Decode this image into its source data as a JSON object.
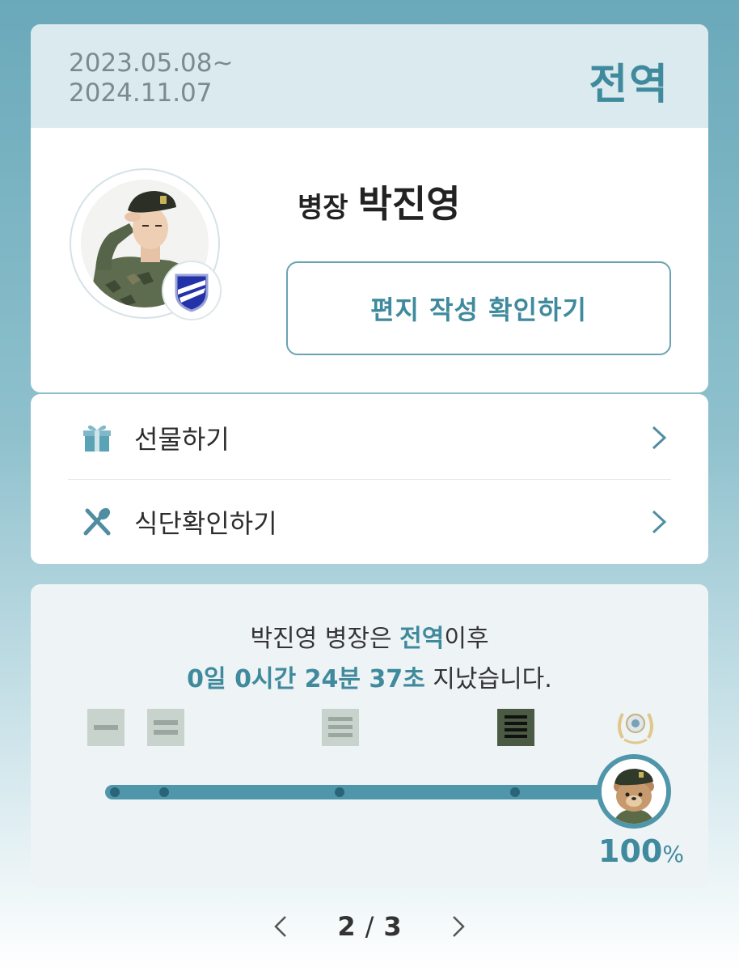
{
  "service": {
    "start_date": "2023.05.08~",
    "end_date": "2024.11.07",
    "status": "전역"
  },
  "profile": {
    "rank": "병장",
    "name": "박진영",
    "letter_button_label": "편지 작성 확인하기"
  },
  "menu": {
    "items": [
      {
        "label": "선물하기",
        "icon": "gift-icon"
      },
      {
        "label": "식단확인하기",
        "icon": "utensils-icon"
      }
    ]
  },
  "progress": {
    "message_name": "박진영 병장은 ",
    "message_status": "전역",
    "message_suffix": "이후",
    "elapsed": "0일 0시간 24분 37초",
    "elapsed_suffix": " 지났습니다.",
    "percent_value": "100",
    "percent_sign": "%",
    "fraction": 1.0,
    "ranks": [
      "private-icon",
      "private-first-class-icon",
      "corporal-icon",
      "sergeant-icon"
    ]
  },
  "pager": {
    "current": "2",
    "separator": "/",
    "total": "3"
  },
  "colors": {
    "accent": "#3f8a9d",
    "track": "#4f96aa",
    "header_bg": "#dbeaee"
  }
}
